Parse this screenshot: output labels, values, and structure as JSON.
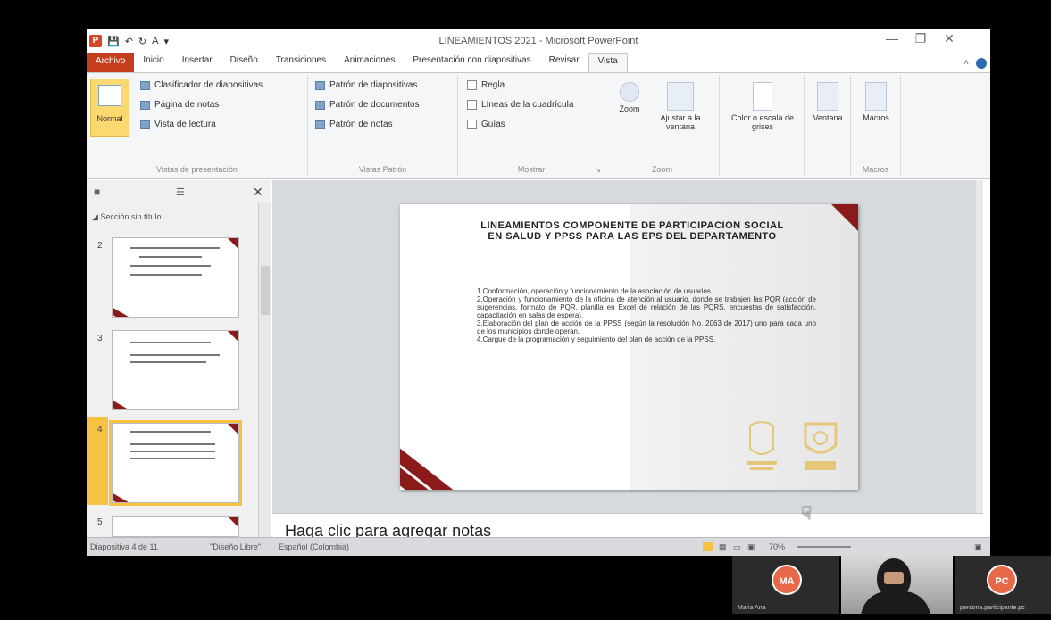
{
  "window": {
    "title": "LINEAMIENTOS 2021 - Microsoft PowerPoint"
  },
  "tabs": [
    "Archivo",
    "Inicio",
    "Insertar",
    "Diseño",
    "Transiciones",
    "Animaciones",
    "Presentación con diapositivas",
    "Revisar",
    "Vista"
  ],
  "active_tab": "Vista",
  "ribbon": {
    "views": {
      "label": "Vistas de presentación",
      "normal": "Normal",
      "items": [
        "Clasificador de diapositivas",
        "Página de notas",
        "Vista de lectura"
      ]
    },
    "masters": {
      "label": "Vistas Patrón",
      "items": [
        "Patrón de diapositivas",
        "Patrón de documentos",
        "Patrón de notas"
      ]
    },
    "show": {
      "label": "Mostrar",
      "items": [
        "Regla",
        "Líneas de la cuadrícula",
        "Guías"
      ]
    },
    "zoom": {
      "label": "Zoom",
      "zoom": "Zoom",
      "fit": "Ajustar a la ventana"
    },
    "color": {
      "label": "Color o escala de grises"
    },
    "window": {
      "label": "Ventana"
    },
    "macros": {
      "label": "Macros",
      "group": "Macros"
    }
  },
  "thumbnails": {
    "section": "Sección sin título",
    "slides": [
      "2",
      "3",
      "4",
      "5"
    ],
    "selected": "4"
  },
  "slide": {
    "title": "LINEAMIENTOS COMPONENTE DE PARTICIPACION SOCIAL EN SALUD Y PPSS PARA LAS EPS DEL DEPARTAMENTO",
    "items": [
      "1.Conformación, operación y funcionamiento de la asociación de usuarios.",
      "2.Operación y funcionamiento de la oficina de atención al usuario, donde se trabajen las PQR (acción de sugerencias, formato de PQR, planilla en Excel de relación de las PQRS, encuestas de satisfacción, capacitación en salas de espera).",
      "3.Elaboración del plan de acción de la PPSS (según la resolución No. 2063 de 2017) uno para cada uno de los municipios donde operan.",
      "4.Cargue de la programación y seguimiento del plan de acción de la PPSS."
    ]
  },
  "notes": {
    "placeholder": "Haga clic para agregar notas"
  },
  "statusbar": {
    "slide_info": "Diapositiva 4 de 11",
    "theme": "\"Diseño Libre\"",
    "language": "Español (Colombia)",
    "zoom": "70%"
  },
  "participants": [
    {
      "initials": "MA",
      "name": "Maria Ana"
    },
    {
      "initials": "",
      "name": ""
    },
    {
      "initials": "PC",
      "name": "persona.participante.pc"
    }
  ],
  "colors": {
    "accent": "#8b1a1a",
    "file_tab": "#c43e1c",
    "selection": "#f5c242",
    "seal_gold": "#e6c77a"
  }
}
